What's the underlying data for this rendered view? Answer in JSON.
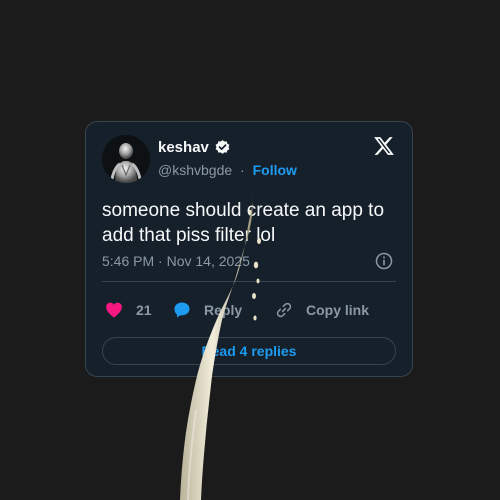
{
  "author": {
    "display_name": "keshav",
    "handle": "@kshvbgde",
    "separator": "·",
    "follow_label": "Follow",
    "verified": true
  },
  "tweet": {
    "text_line1": "someone should create an app to",
    "text_line2": "add that piss filter lol",
    "timestamp": "5:46 PM · Nov 14, 2025"
  },
  "actions": {
    "like_count": "21",
    "reply_label": "Reply",
    "copy_label": "Copy link"
  },
  "replies_button": {
    "label": "Read 4 replies"
  },
  "icons": {
    "brand": "x-logo-icon",
    "verified": "verified-badge-icon",
    "info": "info-icon",
    "like": "heart-icon",
    "reply": "speech-bubble-icon",
    "copy": "link-icon"
  },
  "colors": {
    "page_background": "#1b1b1b",
    "card_background": "#15202b",
    "border": "#38444d",
    "text_primary": "#f7f9f9",
    "text_secondary": "#8b98a5",
    "accent": "#1d9bf0",
    "like": "#f91880"
  }
}
